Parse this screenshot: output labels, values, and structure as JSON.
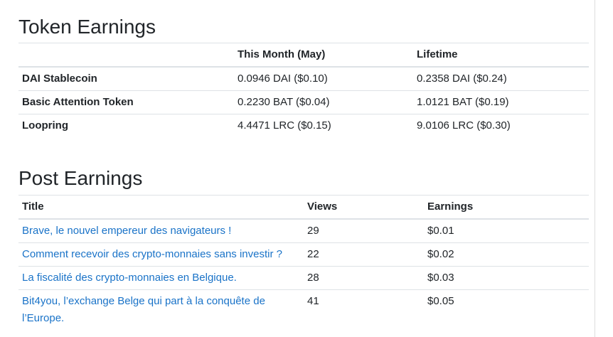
{
  "token_section": {
    "title": "Token Earnings",
    "headers": [
      "",
      "This Month (May)",
      "Lifetime"
    ],
    "rows": [
      {
        "token": "DAI Stablecoin",
        "month": "0.0946 DAI ($0.10)",
        "lifetime": "0.2358 DAI ($0.24)"
      },
      {
        "token": "Basic Attention Token",
        "month": "0.2230 BAT ($0.04)",
        "lifetime": "1.0121 BAT ($0.19)"
      },
      {
        "token": "Loopring",
        "month": "4.4471 LRC ($0.15)",
        "lifetime": "9.0106 LRC ($0.30)"
      }
    ]
  },
  "post_section": {
    "title": "Post Earnings",
    "headers": [
      "Title",
      "Views",
      "Earnings"
    ],
    "rows": [
      {
        "title": "Brave, le nouvel empereur des navigateurs !",
        "views": "29",
        "earnings": "$0.01"
      },
      {
        "title": "Comment recevoir des crypto-monnaies sans investir ?",
        "views": "22",
        "earnings": "$0.02"
      },
      {
        "title": "La fiscalité des crypto-monnaies en Belgique.",
        "views": "28",
        "earnings": "$0.03"
      },
      {
        "title": "Bit4you, l’exchange Belge qui part à la conquête de l’Europe.",
        "views": "41",
        "earnings": "$0.05"
      }
    ]
  },
  "colors": {
    "link": "#1a73c8",
    "text": "#212529",
    "border": "#dee2e6"
  }
}
